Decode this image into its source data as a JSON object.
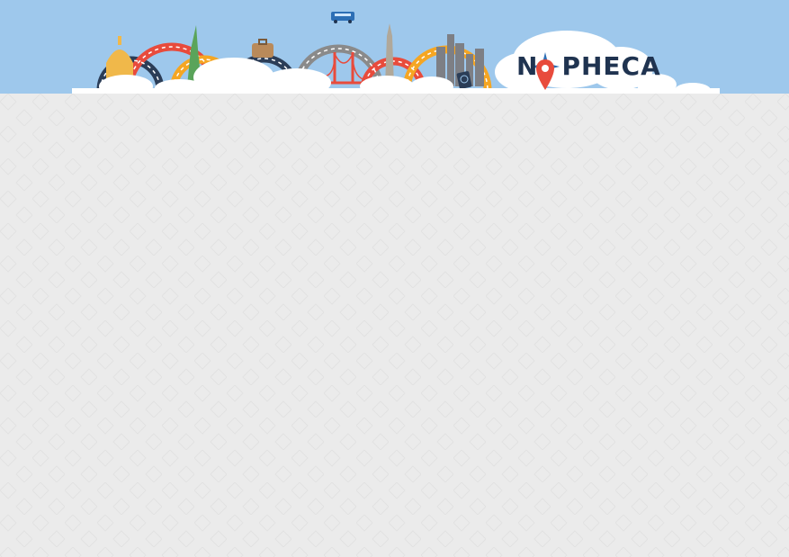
{
  "header": {
    "logo": {
      "brand_part1": "N",
      "brand_part2": "PHECA",
      "pin_icon_color": "#e84b3c",
      "compass_color": "#2d6fb5"
    },
    "banner": {
      "sky_color": "#9ec8ec",
      "arc_colors": [
        "#2b3d57",
        "#e84b3c",
        "#f5a623",
        "#2b3d57",
        "#8a8a8a",
        "#e84b3c",
        "#f5a623"
      ]
    }
  },
  "main": {
    "background_color": "#ebebeb"
  }
}
